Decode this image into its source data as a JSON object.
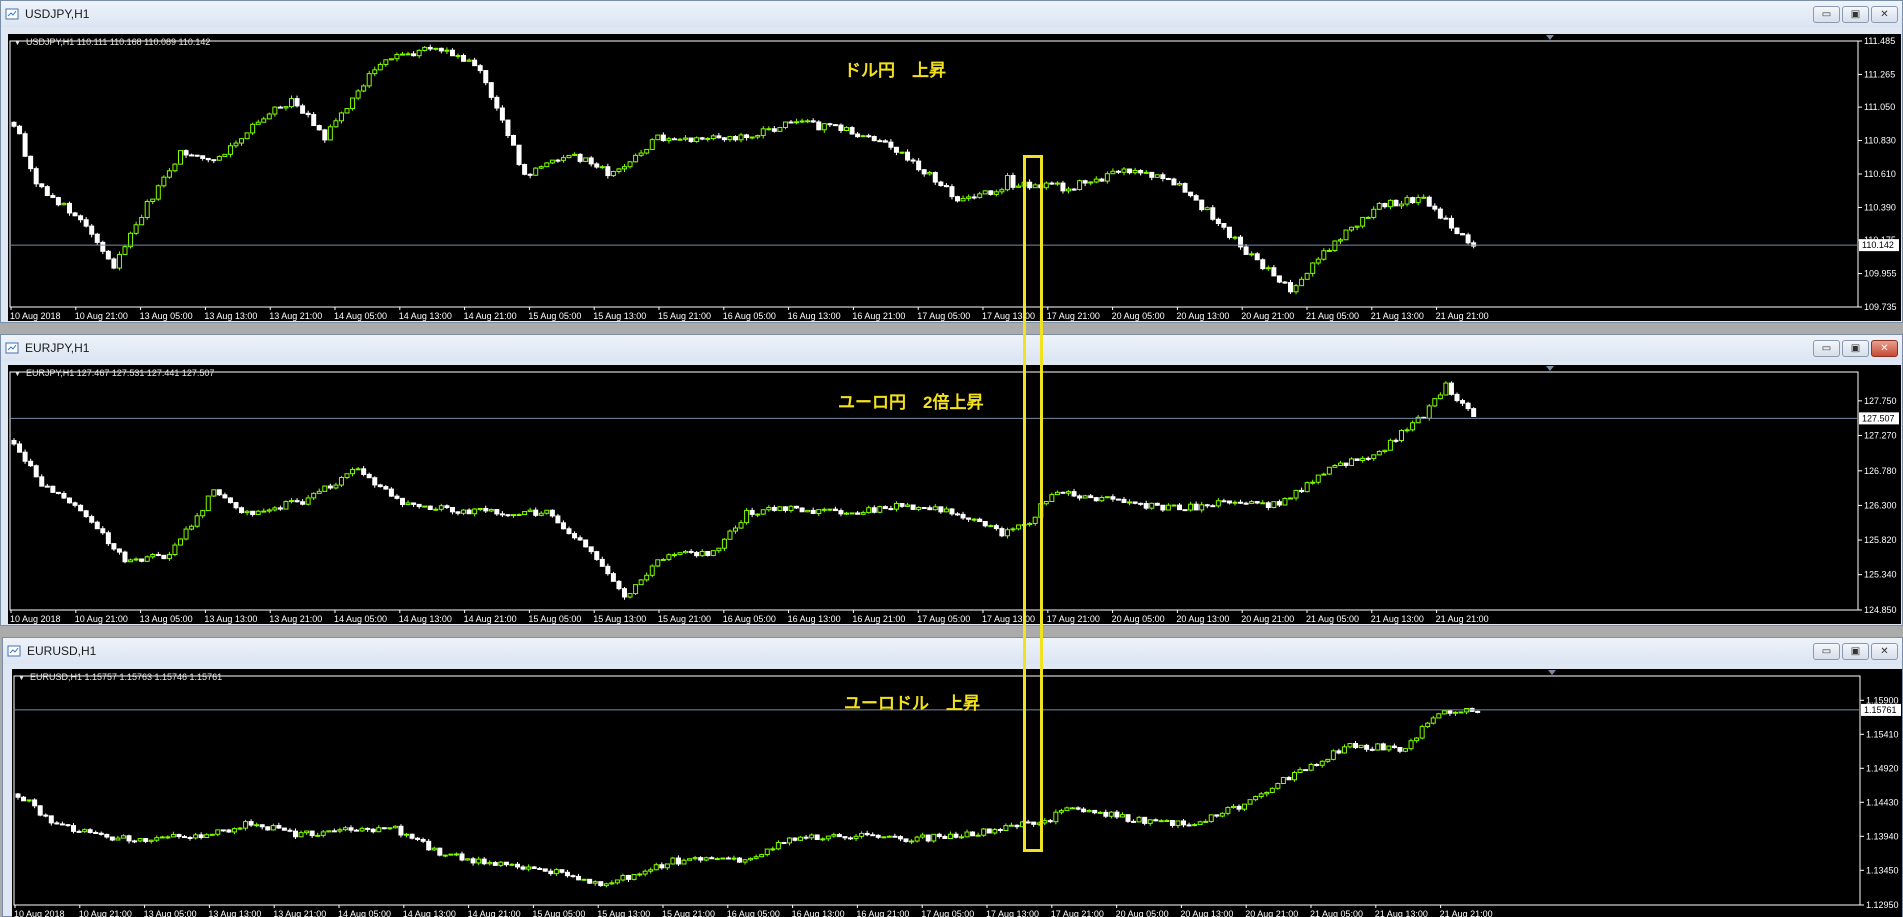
{
  "colors": {
    "up": "#7fff00",
    "down": "#ffffff",
    "bg": "#000000",
    "axis": "#ffffff",
    "priceLine": "#7b8ba4",
    "annotation": "#f4e11c"
  },
  "window_buttons": [
    "▭",
    "▣",
    "✕"
  ],
  "icons": {
    "window": "chart-window-icon",
    "minimize": "minimize-icon",
    "restore": "restore-icon",
    "close": "close-icon",
    "dropdown": "triangle-down-icon"
  },
  "timeline": [
    "10 Aug 2018",
    "10 Aug 21:00",
    "13 Aug 05:00",
    "13 Aug 13:00",
    "13 Aug 21:00",
    "14 Aug 05:00",
    "14 Aug 13:00",
    "14 Aug 21:00",
    "15 Aug 05:00",
    "15 Aug 13:00",
    "15 Aug 21:00",
    "16 Aug 05:00",
    "16 Aug 13:00",
    "16 Aug 21:00",
    "17 Aug 05:00",
    "17 Aug 13:00",
    "17 Aug 21:00",
    "20 Aug 05:00",
    "20 Aug 13:00",
    "20 Aug 21:00",
    "21 Aug 05:00",
    "21 Aug 13:00",
    "21 Aug 21:00"
  ],
  "windows": [
    {
      "title": "USDJPY,H1",
      "info": "USDJPY,H1  110.111 110.168 110.089 110.142",
      "annotation": "ドル円　上昇",
      "price_labels": [
        "111.485",
        "111.265",
        "111.050",
        "110.830",
        "110.610",
        "110.390",
        "110.175",
        "109.955",
        "109.735"
      ],
      "current": "110.142",
      "ymin": 109.735,
      "ymax": 111.485,
      "anchors": [
        [
          0,
          110.95
        ],
        [
          4,
          110.55
        ],
        [
          12,
          110.3
        ],
        [
          18,
          110.0
        ],
        [
          23,
          110.35
        ],
        [
          30,
          110.75
        ],
        [
          36,
          110.7
        ],
        [
          44,
          110.95
        ],
        [
          50,
          111.1
        ],
        [
          56,
          110.85
        ],
        [
          66,
          111.35
        ],
        [
          76,
          111.45
        ],
        [
          84,
          111.3
        ],
        [
          92,
          110.6
        ],
        [
          100,
          110.75
        ],
        [
          108,
          110.6
        ],
        [
          116,
          110.85
        ],
        [
          124,
          110.85
        ],
        [
          132,
          110.85
        ],
        [
          140,
          110.95
        ],
        [
          150,
          110.9
        ],
        [
          160,
          110.75
        ],
        [
          170,
          110.45
        ],
        [
          178,
          110.5
        ],
        [
          183,
          110.55
        ],
        [
          190,
          110.52
        ],
        [
          202,
          110.65
        ],
        [
          210,
          110.55
        ],
        [
          222,
          110.1
        ],
        [
          230,
          109.85
        ],
        [
          236,
          110.1
        ],
        [
          246,
          110.4
        ],
        [
          254,
          110.45
        ],
        [
          262,
          110.15
        ],
        [
          263,
          110.142
        ]
      ],
      "markers": [
        [
          179,
          110.6
        ],
        [
          183,
          110.52
        ]
      ]
    },
    {
      "title": "EURJPY,H1",
      "info": "EURJPY,H1  127.467 127.531 127.441 127.507",
      "annotation": "ユーロ円　2倍上昇",
      "price_labels": [
        "127.750",
        "127.270",
        "126.780",
        "126.300",
        "125.820",
        "125.340",
        "124.850"
      ],
      "current": "127.507",
      "ymin": 124.85,
      "ymax": 128.15,
      "anchors": [
        [
          0,
          127.2
        ],
        [
          5,
          126.6
        ],
        [
          12,
          126.2
        ],
        [
          20,
          125.55
        ],
        [
          28,
          125.6
        ],
        [
          36,
          126.5
        ],
        [
          42,
          126.2
        ],
        [
          52,
          126.35
        ],
        [
          62,
          126.8
        ],
        [
          70,
          126.35
        ],
        [
          78,
          126.25
        ],
        [
          88,
          126.2
        ],
        [
          96,
          126.2
        ],
        [
          106,
          125.5
        ],
        [
          110,
          125.05
        ],
        [
          118,
          125.65
        ],
        [
          126,
          125.65
        ],
        [
          132,
          126.2
        ],
        [
          140,
          126.25
        ],
        [
          150,
          126.2
        ],
        [
          160,
          126.3
        ],
        [
          170,
          126.2
        ],
        [
          178,
          125.9
        ],
        [
          183,
          126.05
        ],
        [
          187,
          126.5
        ],
        [
          200,
          126.35
        ],
        [
          210,
          126.25
        ],
        [
          220,
          126.35
        ],
        [
          228,
          126.3
        ],
        [
          236,
          126.75
        ],
        [
          246,
          127.05
        ],
        [
          254,
          127.55
        ],
        [
          258,
          127.95
        ],
        [
          263,
          127.507
        ]
      ],
      "markers": [
        [
          183,
          126.05
        ],
        [
          187,
          126.45
        ]
      ]
    },
    {
      "title": "EURUSD,H1",
      "info": "EURUSD,H1  1.15757 1.15763 1.15746 1.15761",
      "annotation": "ユーロドル　上昇",
      "price_labels": [
        "1.15900",
        "1.15410",
        "1.14920",
        "1.14430",
        "1.13940",
        "1.13450",
        "1.12950"
      ],
      "current": "1.15761",
      "ymin": 1.1295,
      "ymax": 1.1625,
      "anchors": [
        [
          0,
          1.1455
        ],
        [
          6,
          1.1415
        ],
        [
          14,
          1.1395
        ],
        [
          24,
          1.139
        ],
        [
          34,
          1.1395
        ],
        [
          42,
          1.1415
        ],
        [
          50,
          1.1395
        ],
        [
          60,
          1.1405
        ],
        [
          68,
          1.1405
        ],
        [
          76,
          1.137
        ],
        [
          84,
          1.1355
        ],
        [
          96,
          1.1345
        ],
        [
          104,
          1.1325
        ],
        [
          110,
          1.1335
        ],
        [
          118,
          1.1358
        ],
        [
          130,
          1.136
        ],
        [
          140,
          1.139
        ],
        [
          150,
          1.1395
        ],
        [
          160,
          1.139
        ],
        [
          170,
          1.1395
        ],
        [
          178,
          1.1405
        ],
        [
          184,
          1.1415
        ],
        [
          190,
          1.1435
        ],
        [
          200,
          1.142
        ],
        [
          212,
          1.141
        ],
        [
          222,
          1.1445
        ],
        [
          230,
          1.1485
        ],
        [
          240,
          1.1525
        ],
        [
          250,
          1.152
        ],
        [
          256,
          1.1575
        ],
        [
          263,
          1.15761
        ]
      ],
      "markers": [
        [
          186,
          1.1415
        ],
        [
          190,
          1.1435
        ]
      ]
    }
  ]
}
